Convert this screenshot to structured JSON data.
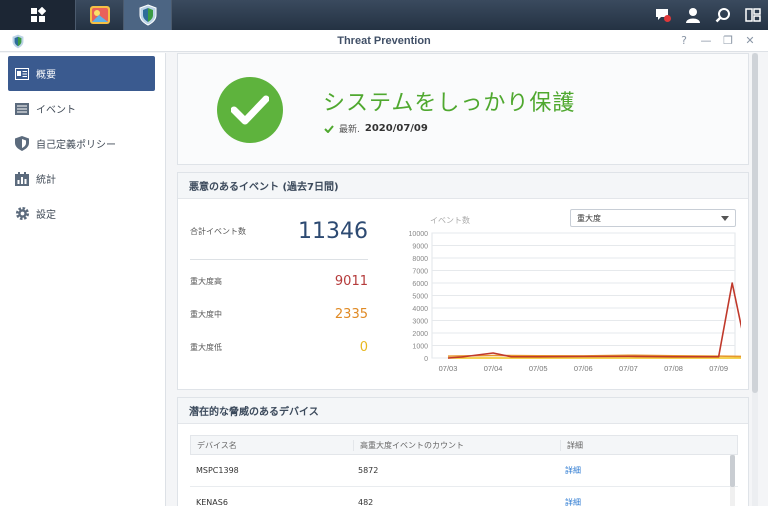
{
  "window": {
    "title": "Threat Prevention"
  },
  "sidebar": {
    "items": [
      {
        "label": "概要",
        "icon": "overview-icon",
        "active": true
      },
      {
        "label": "イベント",
        "icon": "list-icon",
        "active": false
      },
      {
        "label": "自己定義ポリシー",
        "icon": "shield-icon",
        "active": false
      },
      {
        "label": "統計",
        "icon": "stats-icon",
        "active": false
      },
      {
        "label": "設定",
        "icon": "gear-icon",
        "active": false
      }
    ]
  },
  "status": {
    "headline": "システムをしっかり保護",
    "updated_label": "最新.",
    "updated_date": "2020/07/09"
  },
  "events": {
    "title": "悪意のあるイベント (過去7日間)",
    "total_label": "合計イベント数",
    "total_value": "11346",
    "high_label": "重大度高",
    "high_value": "9011",
    "mid_label": "重大度中",
    "mid_value": "2335",
    "low_label": "重大度低",
    "low_value": "0",
    "dropdown_value": "重大度"
  },
  "chart_data": {
    "type": "line",
    "ylabel": "イベント数",
    "ylim": [
      0,
      10000
    ],
    "yticks": [
      0,
      1000,
      2000,
      3000,
      4000,
      5000,
      6000,
      7000,
      8000,
      9000,
      10000
    ],
    "categories": [
      "07/03",
      "07/04",
      "07/05",
      "07/06",
      "07/07",
      "07/08",
      "07/09"
    ],
    "series": [
      {
        "name": "high",
        "color": "#c0392b",
        "x": [
          0,
          0.3,
          1.0,
          1.4,
          2,
          3,
          4,
          5,
          5.0,
          5.5,
          5.9,
          6.0,
          6.3,
          6.65
        ],
        "values": [
          0,
          80,
          400,
          100,
          100,
          120,
          130,
          100,
          100,
          100,
          100,
          100,
          6000,
          0
        ]
      },
      {
        "name": "mid",
        "color": "#e6962e",
        "x": [
          0,
          1,
          2,
          3,
          4,
          5,
          6,
          6.65
        ],
        "values": [
          150,
          200,
          180,
          170,
          220,
          180,
          150,
          120
        ]
      },
      {
        "name": "low",
        "color": "#f0c419",
        "x": [
          0,
          6.65
        ],
        "values": [
          0,
          0
        ]
      }
    ]
  },
  "devices": {
    "title": "潜在的な脅威のあるデバイス",
    "columns": [
      "デバイス名",
      "高重大度イベントのカウント",
      "詳細"
    ],
    "rows": [
      {
        "name": "MSPC1398",
        "count": "5872",
        "detail": "詳細"
      },
      {
        "name": "KENAS6",
        "count": "482",
        "detail": "詳細"
      }
    ]
  },
  "colors": {
    "accent": "#3a5a8f",
    "ok": "#5eb33d",
    "high": "#c0392b",
    "mid": "#e6962e",
    "low": "#f0c419"
  }
}
